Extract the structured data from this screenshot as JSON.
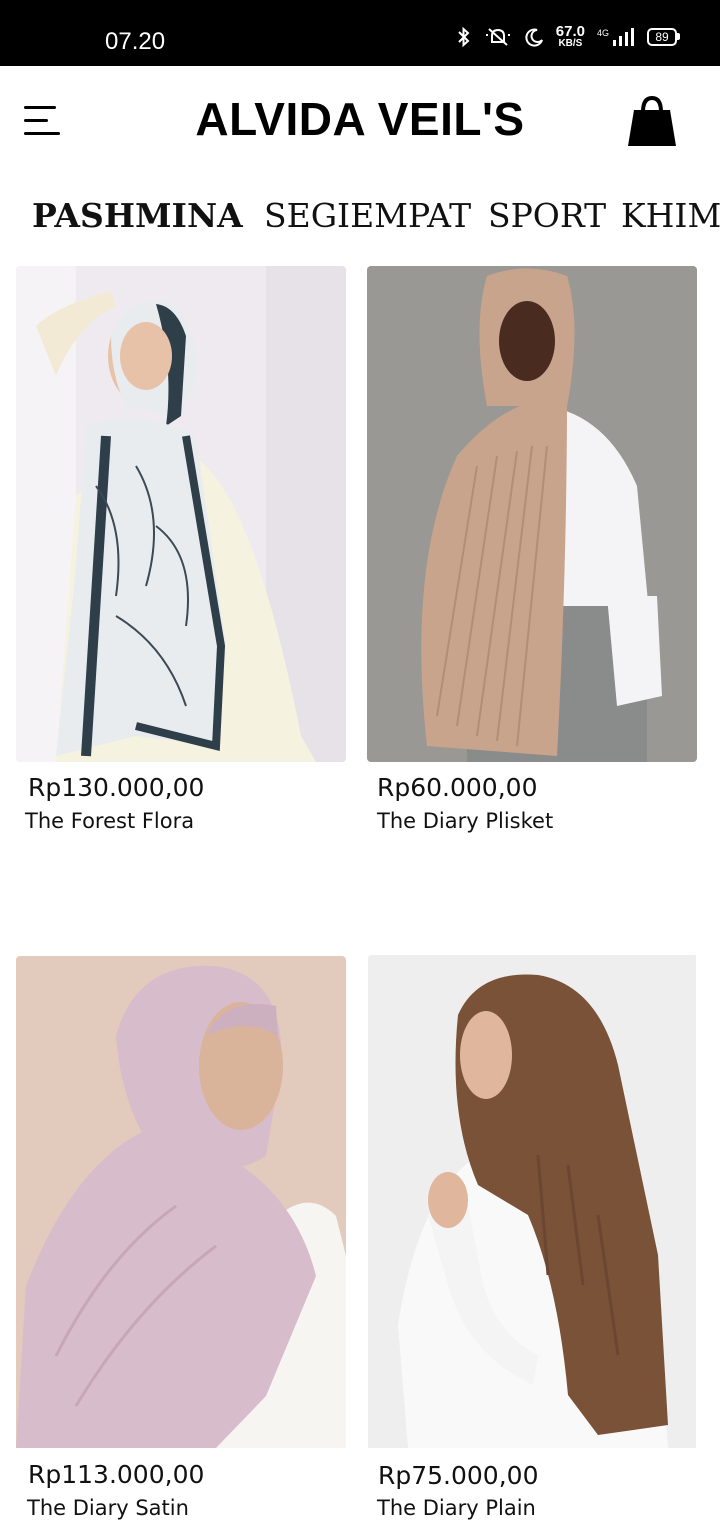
{
  "status_bar": {
    "time": "07.20",
    "net_speed_value": "67.0",
    "net_speed_unit": "KB/S",
    "network": "4G",
    "battery": "89",
    "icons": [
      "bluetooth-icon",
      "mute-icon",
      "moon-icon",
      "signal-icon",
      "battery-icon"
    ]
  },
  "header": {
    "brand": "ALVIDA VEIL'S",
    "menu_icon": "hamburger-menu-icon",
    "cart_icon": "shopping-bag-icon"
  },
  "tabs": [
    {
      "label": "PASHMINA",
      "active": true
    },
    {
      "label": "SEGIEMPAT",
      "active": false
    },
    {
      "label": "SPORT",
      "active": false
    },
    {
      "label": "KHIMAR",
      "active": false
    }
  ],
  "products": [
    {
      "price": "Rp130.000,00",
      "name": "The Forest Flora",
      "hijab_color": "#e9ecef",
      "bg_color": "#eeeaf0"
    },
    {
      "price": "Rp60.000,00",
      "name": "The Diary Plisket",
      "hijab_color": "#c9a48c",
      "bg_color": "#9a9894"
    },
    {
      "price": "Rp113.000,00",
      "name": "The Diary Satin",
      "hijab_color": "#d7bccb",
      "bg_color": "#e2cbbd"
    },
    {
      "price": "Rp75.000,00",
      "name": "The Diary Plain",
      "hijab_color": "#7a5238",
      "bg_color": "#efeeee"
    }
  ]
}
